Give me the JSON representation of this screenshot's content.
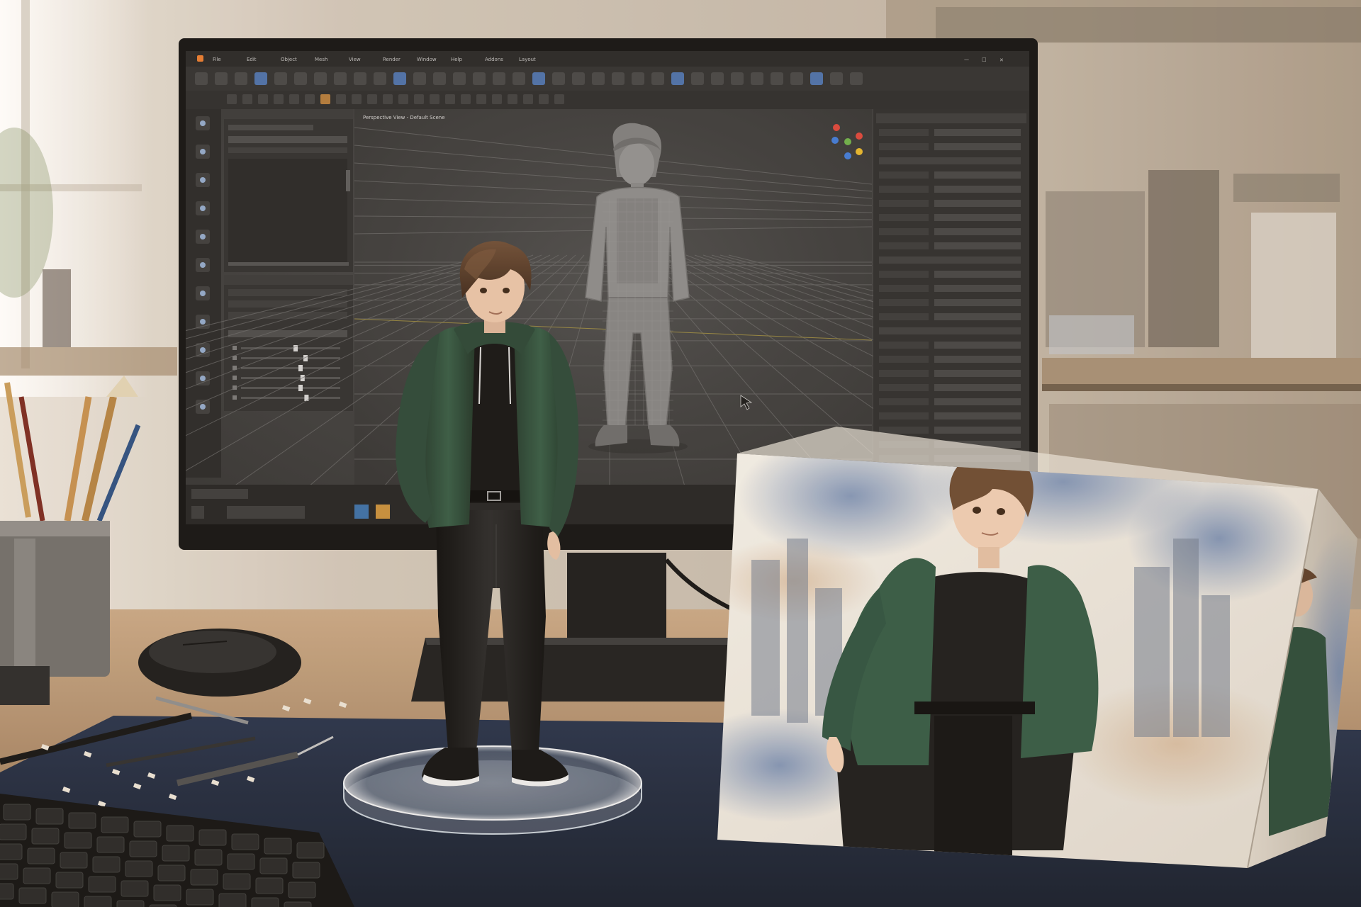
{
  "scene": {
    "viewport_label": "Perspective View - Default Scene",
    "menu_items": [
      "File",
      "Edit",
      "Object",
      "Mesh",
      "View",
      "Render",
      "Window",
      "Help",
      "Addons",
      "Layout"
    ],
    "colors": {
      "wall": "#d9d0c4",
      "desk": "#b39372",
      "mat": "#1f2a3e",
      "screen_bg": "#3a3a3a",
      "panel": "#2b2b2b",
      "hoodie": "#2f4b3a",
      "pants": "#1a1a1a",
      "hair": "#5b4030",
      "skin": "#e3bfa4"
    },
    "icons": [
      "cursor-icon",
      "move-icon",
      "rotate-icon",
      "scale-icon",
      "brush-icon",
      "knife-icon",
      "eye-icon",
      "camera-icon",
      "light-icon",
      "grid-icon",
      "settings-icon"
    ]
  }
}
